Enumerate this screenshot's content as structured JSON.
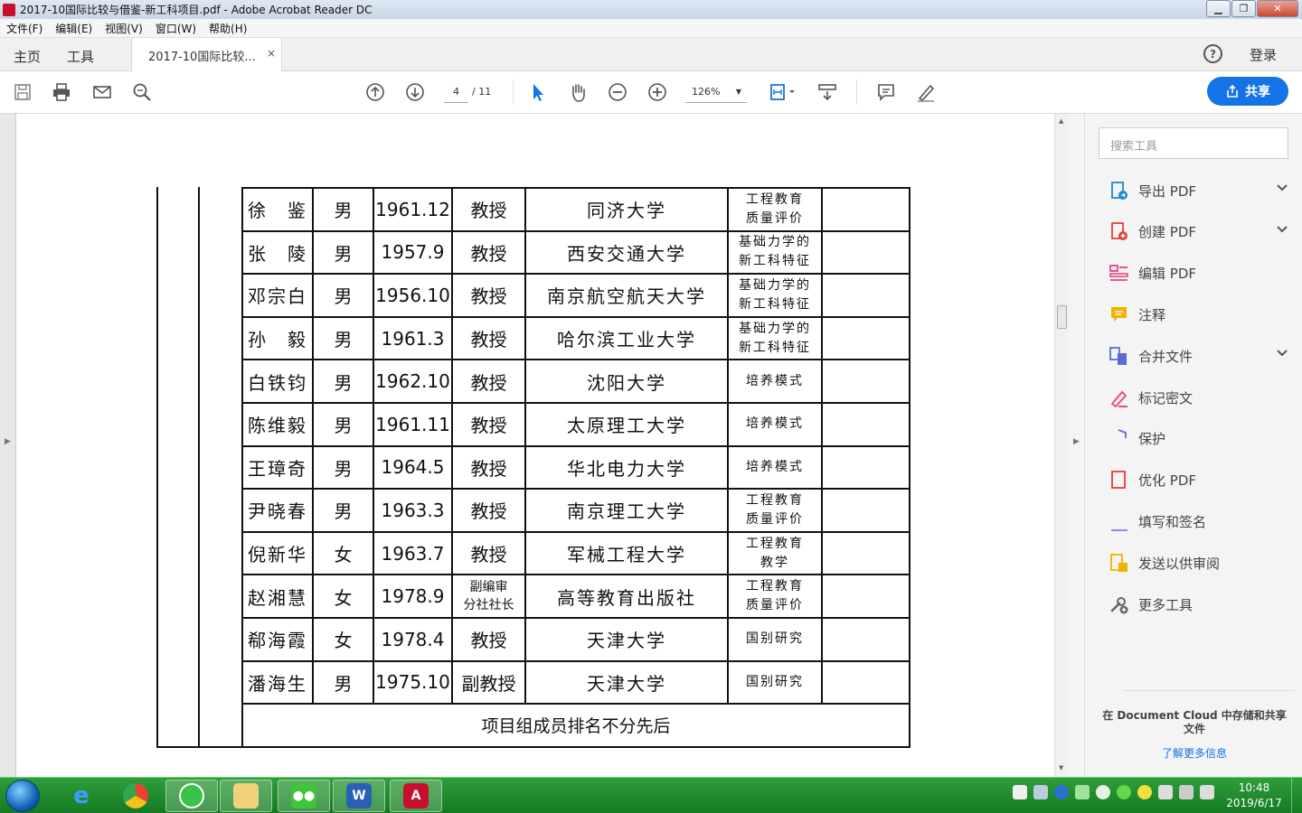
{
  "window": {
    "title": "2017-10国际比较与借鉴-新工科项目.pdf - Adobe Acrobat Reader DC"
  },
  "menubar": {
    "items": [
      "文件(F)",
      "编辑(E)",
      "视图(V)",
      "窗口(W)",
      "帮助(H)"
    ]
  },
  "tabs": {
    "home": "主页",
    "tools": "工具",
    "document": "2017-10国际比较...",
    "close": "×"
  },
  "header": {
    "help": "?",
    "login": "登录"
  },
  "toolbar": {
    "page_current": "4",
    "page_total": "/ 11",
    "zoom": "126%",
    "share": "共享"
  },
  "table": {
    "rows": [
      {
        "name": "徐　鉴",
        "gender": "男",
        "birth": "1961.12",
        "title": [
          "教授"
        ],
        "unit": "同济大学",
        "topic": [
          "工程教育",
          "质量评价"
        ]
      },
      {
        "name": "张　陵",
        "gender": "男",
        "birth": "1957.9",
        "title": [
          "教授"
        ],
        "unit": "西安交通大学",
        "topic": [
          "基础力学的",
          "新工科特征"
        ]
      },
      {
        "name": "邓宗白",
        "gender": "男",
        "birth": "1956.10",
        "title": [
          "教授"
        ],
        "unit": "南京航空航天大学",
        "topic": [
          "基础力学的",
          "新工科特征"
        ]
      },
      {
        "name": "孙　毅",
        "gender": "男",
        "birth": "1961.3",
        "title": [
          "教授"
        ],
        "unit": "哈尔滨工业大学",
        "topic": [
          "基础力学的",
          "新工科特征"
        ]
      },
      {
        "name": "白铁钧",
        "gender": "男",
        "birth": "1962.10",
        "title": [
          "教授"
        ],
        "unit": "沈阳大学",
        "topic": [
          "培养模式"
        ]
      },
      {
        "name": "陈维毅",
        "gender": "男",
        "birth": "1961.11",
        "title": [
          "教授"
        ],
        "unit": "太原理工大学",
        "topic": [
          "培养模式"
        ]
      },
      {
        "name": "王璋奇",
        "gender": "男",
        "birth": "1964.5",
        "title": [
          "教授"
        ],
        "unit": "华北电力大学",
        "topic": [
          "培养模式"
        ]
      },
      {
        "name": "尹晓春",
        "gender": "男",
        "birth": "1963.3",
        "title": [
          "教授"
        ],
        "unit": "南京理工大学",
        "topic": [
          "工程教育",
          "质量评价"
        ]
      },
      {
        "name": "倪新华",
        "gender": "女",
        "birth": "1963.7",
        "title": [
          "教授"
        ],
        "unit": "军械工程大学",
        "topic": [
          "工程教育",
          "教学"
        ]
      },
      {
        "name": "赵湘慧",
        "gender": "女",
        "birth": "1978.9",
        "title": [
          "副编审",
          "分社社长"
        ],
        "unit": "高等教育出版社",
        "topic": [
          "工程教育",
          "质量评价"
        ]
      },
      {
        "name": "郗海霞",
        "gender": "女",
        "birth": "1978.4",
        "title": [
          "教授"
        ],
        "unit": "天津大学",
        "topic": [
          "国别研究"
        ]
      },
      {
        "name": "潘海生",
        "gender": "男",
        "birth": "1975.10",
        "title": [
          "副教授"
        ],
        "unit": "天津大学",
        "topic": [
          "国别研究"
        ]
      }
    ],
    "footer": "项目组成员排名不分先后"
  },
  "right_panel": {
    "search_placeholder": "搜索工具",
    "tools": [
      {
        "label": "导出 PDF",
        "icon": "export-pdf-icon",
        "expandable": true,
        "color": "#1a8bd0"
      },
      {
        "label": "创建 PDF",
        "icon": "create-pdf-icon",
        "expandable": true,
        "color": "#e2403a"
      },
      {
        "label": "编辑 PDF",
        "icon": "edit-pdf-icon",
        "expandable": false,
        "color": "#e8438b"
      },
      {
        "label": "注释",
        "icon": "comment-icon",
        "expandable": false,
        "color": "#f0b400"
      },
      {
        "label": "合并文件",
        "icon": "combine-files-icon",
        "expandable": true,
        "color": "#5a6cd8"
      },
      {
        "label": "标记密文",
        "icon": "redact-icon",
        "expandable": false,
        "color": "#e8438b"
      },
      {
        "label": "保护",
        "icon": "protect-icon",
        "expandable": false,
        "color": "#5a6cd8"
      },
      {
        "label": "优化 PDF",
        "icon": "optimize-pdf-icon",
        "expandable": false,
        "color": "#e2403a"
      },
      {
        "label": "填写和签名",
        "icon": "fill-sign-icon",
        "expandable": false,
        "color": "#8a5cd8"
      },
      {
        "label": "发送以供审阅",
        "icon": "send-review-icon",
        "expandable": false,
        "color": "#f0b400"
      },
      {
        "label": "更多工具",
        "icon": "more-tools-icon",
        "expandable": false,
        "color": "#666666"
      }
    ],
    "doc_cloud_text": "在 Document Cloud 中存储和共享文件",
    "doc_cloud_link": "了解更多信息"
  },
  "taskbar": {
    "time": "10:48",
    "date": "2019/6/17"
  }
}
